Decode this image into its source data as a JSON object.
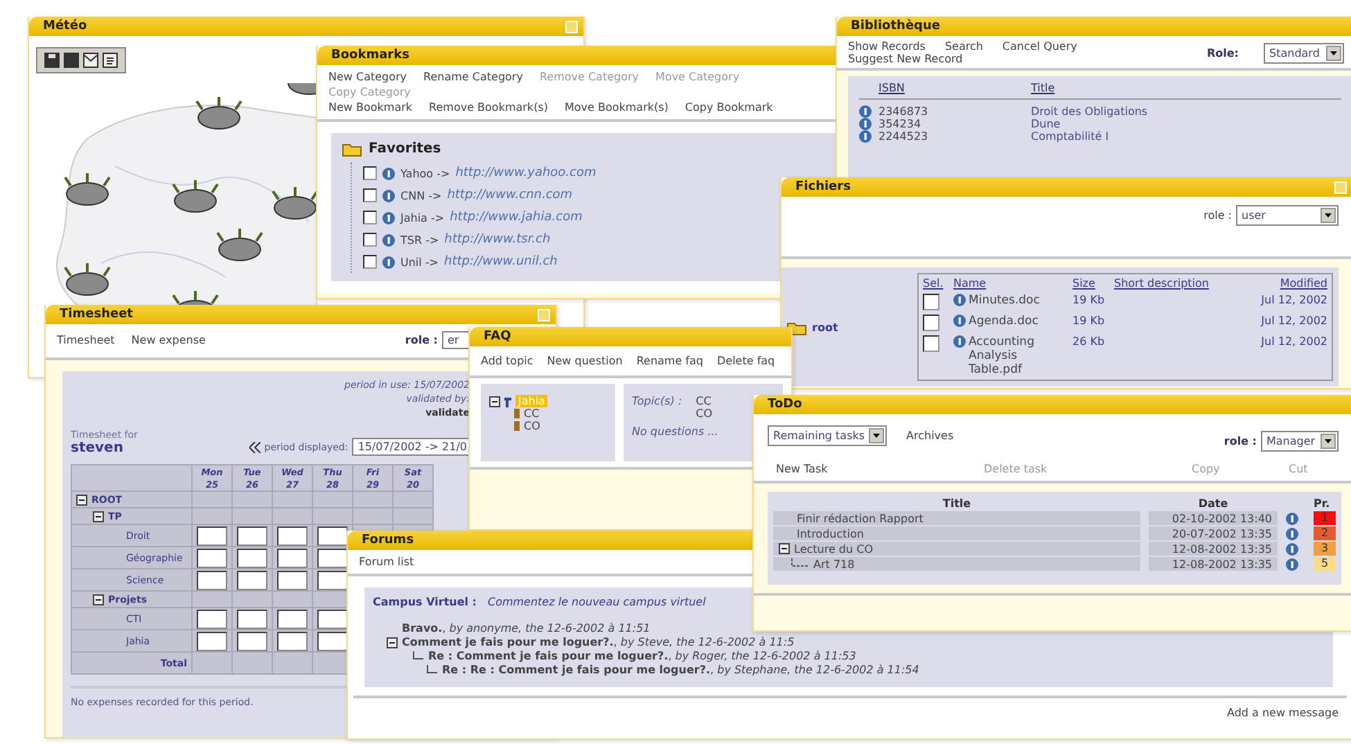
{
  "meteo": {
    "title": "Météo"
  },
  "bookmarks": {
    "title": "Bookmarks",
    "category_actions": [
      {
        "label": "New Category",
        "disabled": false
      },
      {
        "label": "Rename Category",
        "disabled": false
      },
      {
        "label": "Remove Category",
        "disabled": true
      },
      {
        "label": "Move Category",
        "disabled": true
      },
      {
        "label": "Copy Category",
        "disabled": true
      }
    ],
    "bookmark_actions": [
      "New Bookmark",
      "Remove Bookmark(s)",
      "Move Bookmark(s)",
      "Copy Bookmark"
    ],
    "folder": "Favorites",
    "items": [
      {
        "label": "Yahoo ->",
        "url": "http://www.yahoo.com",
        "checked": false
      },
      {
        "label": "CNN ->",
        "url": "http://www.cnn.com",
        "checked": false
      },
      {
        "label": "Jahia ->",
        "url": "http://www.jahia.com",
        "checked": false
      },
      {
        "label": "TSR ->",
        "url": "http://www.tsr.ch",
        "checked": false
      },
      {
        "label": "Unil ->",
        "url": "http://www.unil.ch",
        "checked": false
      }
    ]
  },
  "bibliotheque": {
    "title": "Bibliothèque",
    "actions": [
      "Show Records",
      "Search",
      "Cancel Query"
    ],
    "suggest": "Suggest New Record",
    "role_label": "Role:",
    "role_value": "Standard",
    "columns": [
      "ISBN",
      "Title"
    ],
    "rows": [
      {
        "isbn": "2346873",
        "title": "Droit des Obligations"
      },
      {
        "isbn": "354234",
        "title": "Dune"
      },
      {
        "isbn": "2244523",
        "title": "Comptabilité I"
      }
    ]
  },
  "fichiers": {
    "title": "Fichiers",
    "role_label": "role :",
    "role_value": "user",
    "folder": "root",
    "columns": [
      "Sel.",
      "Name",
      "Size",
      "Short description",
      "Modified"
    ],
    "rows": [
      {
        "checked": false,
        "name": "Minutes.doc",
        "size": "19 Kb",
        "modified": "Jul 12, 2002"
      },
      {
        "checked": false,
        "name": "Agenda.doc",
        "size": "19 Kb",
        "modified": "Jul 12, 2002"
      },
      {
        "checked": false,
        "name": "Accounting Analysis Table.pdf",
        "size": "26 Kb",
        "modified": "Jul 12, 2002"
      }
    ]
  },
  "timesheet": {
    "title": "Timesheet",
    "tabs": [
      "Timesheet",
      "New expense"
    ],
    "role_label": "role :",
    "role_value": "er",
    "period_in_use": "period in use: 15/07/2002",
    "validated_label": "validated by:",
    "validator": "validate",
    "for_label": "Timesheet for",
    "user": "steven",
    "period_label": "period displayed:",
    "period_value": "15/07/2002 -> 21/0",
    "days": [
      {
        "day": "Mon",
        "date": "25"
      },
      {
        "day": "Tue",
        "date": "26"
      },
      {
        "day": "Wed",
        "date": "27"
      },
      {
        "day": "Thu",
        "date": "28"
      },
      {
        "day": "Fri",
        "date": "29"
      },
      {
        "day": "Sat",
        "date": "20"
      }
    ],
    "tree": [
      {
        "label": "ROOT",
        "expanded": true,
        "children": [
          {
            "label": "TP",
            "expanded": true,
            "children": [
              {
                "label": "Droit"
              },
              {
                "label": "Géographie"
              },
              {
                "label": "Science"
              }
            ]
          },
          {
            "label": "Projets",
            "expanded": true,
            "children": [
              {
                "label": "CTI"
              },
              {
                "label": "Jahia"
              }
            ]
          }
        ]
      }
    ],
    "total_label": "Total",
    "note": "No expenses recorded for this period."
  },
  "faq": {
    "title": "FAQ",
    "actions": [
      "Add topic",
      "New question",
      "Rename faq",
      "Delete faq"
    ],
    "tree": {
      "label": "Jahia",
      "selected": true,
      "expanded": true,
      "children": [
        {
          "label": "CC"
        },
        {
          "label": "CO"
        }
      ]
    },
    "topics_label": "Topic(s) :",
    "topics": [
      "CC",
      "CO"
    ],
    "empty": "No questions ..."
  },
  "forums": {
    "title": "Forums",
    "tab": "Forum list",
    "forum_name": "Campus Virtuel :",
    "forum_description": "Commentez le nouveau campus virtuel",
    "posts": [
      {
        "text": "**Bravo.**, *by anonyme, the 12-6-2002 à 11:51*",
        "expanded": false
      },
      {
        "text": "**Comment je fais pour me loguer?.**, *by Steve, the 12-6-2002 à 11:5*",
        "expanded": true,
        "children": [
          {
            "text": "**Re : Comment je fais pour me loguer?.**, *by Roger, the 12-6-2002 à 11:53*",
            "expanded": false,
            "children": [
              {
                "text": "**Re : Re : Comment je fais pour me loguer?.**, *by Stephane, the 12-6-2002 à 11:54*",
                "expanded": false
              }
            ]
          }
        ]
      }
    ],
    "add_link": "Add a new message"
  },
  "todo": {
    "title": "ToDo",
    "view": "Remaining tasks",
    "archives": "Archives",
    "role_label": "role :",
    "role_value": "Manager",
    "actions": [
      {
        "label": "New Task",
        "disabled": false
      },
      {
        "label": "Delete task",
        "disabled": true
      },
      {
        "label": "Copy",
        "disabled": true
      },
      {
        "label": "Cut",
        "disabled": true
      }
    ],
    "columns": [
      "Title",
      "Date",
      "Pr."
    ],
    "tasks": [
      {
        "title": "Finir rédaction Rapport",
        "date": "02-10-2002 13:40",
        "priority": "1",
        "color": "#ee1111",
        "expanded": false
      },
      {
        "title": "Introduction",
        "date": "20-07-2002 13:35",
        "priority": "2",
        "color": "#e85a30",
        "expanded": false
      },
      {
        "title": "Lecture du CO",
        "date": "12-08-2002 13:35",
        "priority": "3",
        "color": "#f0a040",
        "expanded": true,
        "children": [
          {
            "title": "Art 718",
            "date": "12-08-2002 13:35",
            "priority": "5",
            "color": "#f8dc88",
            "expanded": false
          }
        ]
      }
    ]
  }
}
